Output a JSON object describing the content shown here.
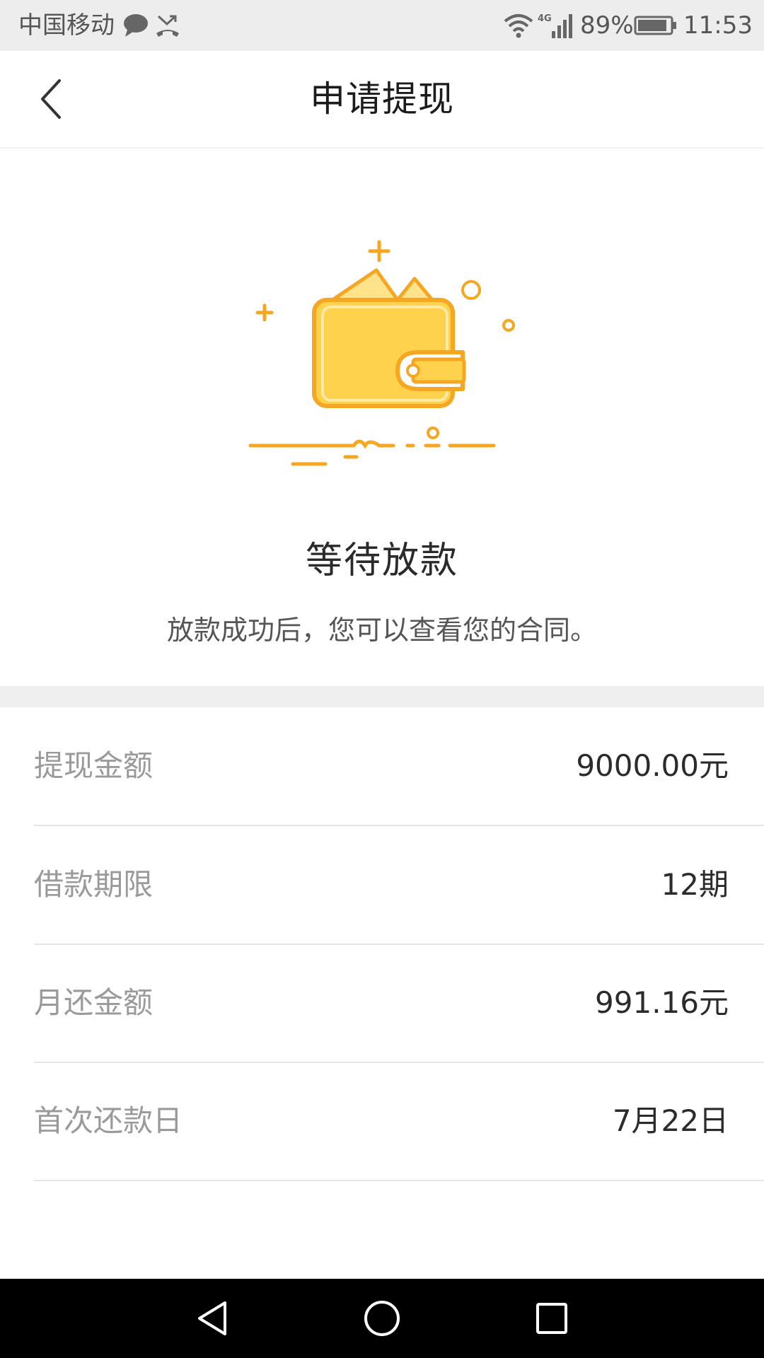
{
  "status_bar": {
    "carrier": "中国移动",
    "battery_percent": "89%",
    "time": "11:53",
    "network_type": "4G",
    "icons": [
      "message-icon",
      "missed-call-icon",
      "wifi-icon",
      "signal-icon",
      "battery-icon"
    ]
  },
  "header": {
    "title": "申请提现",
    "back_icon": "back-arrow-icon"
  },
  "status": {
    "illustration": "wallet-illustration",
    "title": "等待放款",
    "subtitle": "放款成功后，您可以查看您的合同。"
  },
  "details": [
    {
      "label": "提现金额",
      "value": "9000.00元"
    },
    {
      "label": "借款期限",
      "value": "12期"
    },
    {
      "label": "月还金额",
      "value": "991.16元"
    },
    {
      "label": "首次还款日",
      "value": "7月22日"
    }
  ],
  "nav_bar": {
    "icons": [
      "back-triangle-icon",
      "home-circle-icon",
      "recents-square-icon"
    ]
  },
  "colors": {
    "accent": "#f5a623",
    "wallet_fill": "#ffd24d",
    "status_bar_bg": "#ededed",
    "label_text": "#9a9a9a",
    "value_text": "#2b2b2b"
  }
}
